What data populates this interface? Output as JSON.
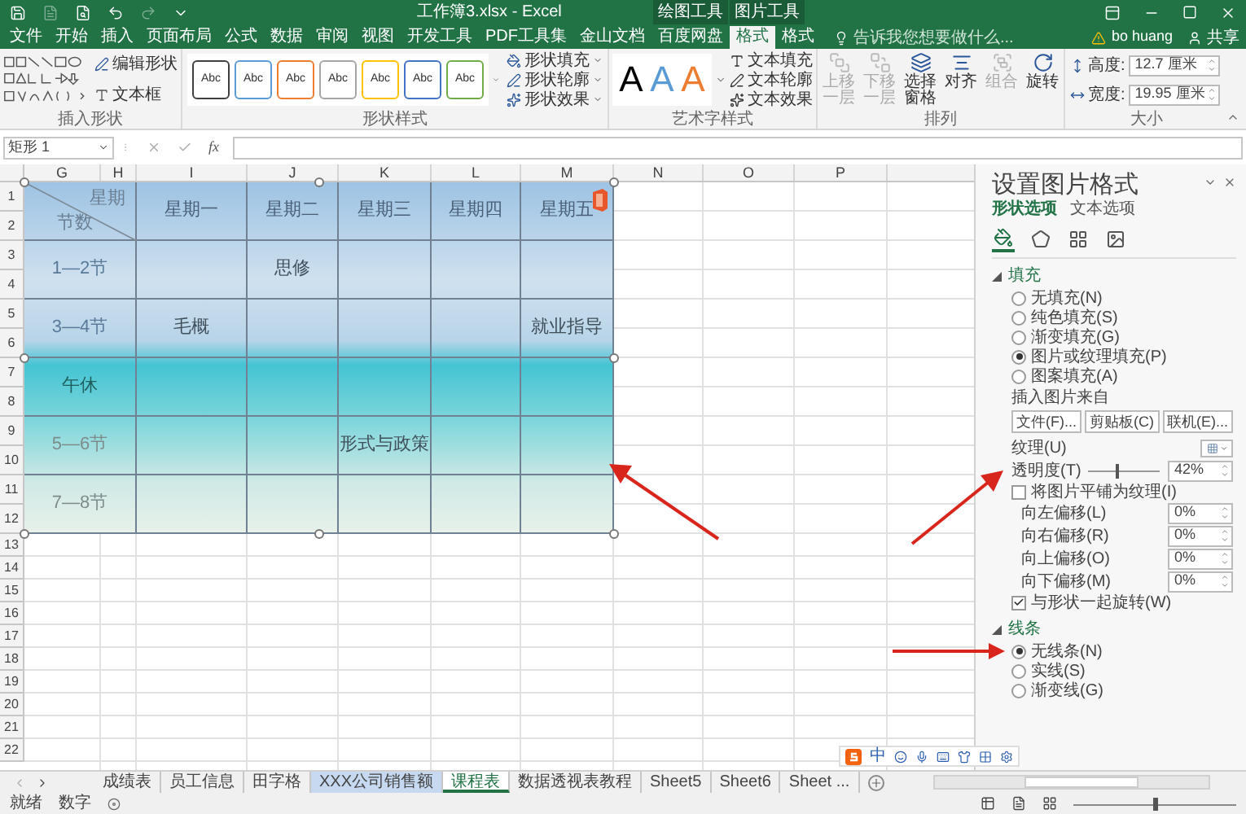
{
  "title_bar": {
    "title": "工作簿3.xlsx - Excel",
    "context_groups": [
      "绘图工具",
      "图片工具"
    ]
  },
  "ribbon_tabs": [
    {
      "label": "文件",
      "selected": false
    },
    {
      "label": "开始",
      "selected": false
    },
    {
      "label": "插入",
      "selected": false
    },
    {
      "label": "页面布局",
      "selected": false
    },
    {
      "label": "公式",
      "selected": false
    },
    {
      "label": "数据",
      "selected": false
    },
    {
      "label": "审阅",
      "selected": false
    },
    {
      "label": "视图",
      "selected": false
    },
    {
      "label": "开发工具",
      "selected": false
    },
    {
      "label": "PDF工具集",
      "selected": false
    },
    {
      "label": "金山文档",
      "selected": false
    },
    {
      "label": "百度网盘",
      "selected": false
    },
    {
      "label": "格式",
      "selected": true
    },
    {
      "label": "格式",
      "selected": false
    }
  ],
  "tell_me": {
    "placeholder": "告诉我您想要做什么..."
  },
  "account": {
    "user": "bo huang",
    "share": "共享"
  },
  "ribbon": {
    "insert_shapes": {
      "label": "插入形状",
      "edit_shape": "编辑形状",
      "text_box": "文本框"
    },
    "shape_styles": {
      "label": "形状样式",
      "presets": [
        {
          "text": "Abc",
          "color": "#404040"
        },
        {
          "text": "Abc",
          "color": "#5b9bd5"
        },
        {
          "text": "Abc",
          "color": "#ed7d31"
        },
        {
          "text": "Abc",
          "color": "#a5a5a5"
        },
        {
          "text": "Abc",
          "color": "#ffc000"
        },
        {
          "text": "Abc",
          "color": "#4472c4"
        },
        {
          "text": "Abc",
          "color": "#70ad47"
        }
      ],
      "commands": [
        "形状填充",
        "形状轮廓",
        "形状效果"
      ]
    },
    "wordart_styles": {
      "label": "艺术字样式",
      "presets": [
        {
          "text": "A",
          "color": "#000000"
        },
        {
          "text": "A",
          "color": "#5b9bd5"
        },
        {
          "text": "A",
          "color": "#ed7d31"
        }
      ],
      "commands": [
        "文本填充",
        "文本轮廓",
        "文本效果"
      ]
    },
    "arrange": {
      "label": "排列",
      "commands": [
        {
          "label": "上移一层",
          "disabled": true
        },
        {
          "label": "下移一层",
          "disabled": true
        },
        {
          "label": "选择窗格",
          "disabled": false
        },
        {
          "label": "对齐",
          "disabled": false
        },
        {
          "label": "组合",
          "disabled": true
        },
        {
          "label": "旋转",
          "disabled": false
        }
      ]
    },
    "size": {
      "label": "大小",
      "fields": [
        {
          "label": "高度:",
          "value": "12.7 厘米"
        },
        {
          "label": "宽度:",
          "value": "19.95 厘米"
        }
      ]
    }
  },
  "formula_bar": {
    "name_box": "矩形 1",
    "function_button": "fx"
  },
  "sheet": {
    "columns": [
      "G",
      "H",
      "I",
      "J",
      "K",
      "L",
      "M",
      "N",
      "O",
      "P"
    ],
    "rows": [
      "1",
      "2",
      "3",
      "4",
      "5",
      "6",
      "7",
      "8",
      "9",
      "10",
      "11",
      "12",
      "13",
      "14",
      "15",
      "16",
      "17",
      "18",
      "19",
      "20",
      "21",
      "22"
    ]
  },
  "picture": {
    "corner_top": "星期",
    "corner_bottom": "节数",
    "days": [
      "星期一",
      "星期二",
      "星期三",
      "星期四",
      "星期五"
    ],
    "periods": [
      {
        "label": "1—2节",
        "cells": [
          null,
          "思修",
          null,
          null,
          null
        ]
      },
      {
        "label": "3—4节",
        "cells": [
          "毛概",
          null,
          null,
          null,
          "就业指导"
        ]
      },
      {
        "label": "午休",
        "cells": [
          null,
          null,
          null,
          null,
          null
        ]
      },
      {
        "label": "5—6节",
        "cells": [
          null,
          null,
          "形式与政策",
          null,
          null
        ]
      },
      {
        "label": "7—8节",
        "cells": [
          null,
          null,
          null,
          null,
          null
        ]
      }
    ]
  },
  "panel": {
    "title": "设置图片格式",
    "tabs": [
      {
        "label": "形状选项",
        "selected": true
      },
      {
        "label": "文本选项",
        "selected": false
      }
    ],
    "icon_tabs": [
      {
        "kind": "fill",
        "selected": true
      },
      {
        "kind": "effects",
        "selected": false
      },
      {
        "kind": "size",
        "selected": false
      },
      {
        "kind": "picture",
        "selected": false
      }
    ],
    "fill": {
      "label": "填充",
      "expanded": true,
      "options": [
        {
          "label": "无填充(N)",
          "selected": false
        },
        {
          "label": "纯色填充(S)",
          "selected": false
        },
        {
          "label": "渐变填充(G)",
          "selected": false
        },
        {
          "label": "图片或纹理填充(P)",
          "selected": true
        },
        {
          "label": "图案填充(A)",
          "selected": false
        }
      ],
      "source_label": "插入图片来自",
      "buttons": [
        "文件(F)...",
        "剪贴板(C)",
        "联机(E)..."
      ],
      "texture_label": "纹理(U)",
      "transparency": {
        "label": "透明度(T)",
        "level": 0.42,
        "value": "42%"
      },
      "tile": {
        "label": "将图片平铺为纹理(I)",
        "checked": false
      },
      "offsets": [
        {
          "label": "向左偏移(L)",
          "value": "0%"
        },
        {
          "label": "向右偏移(R)",
          "value": "0%"
        },
        {
          "label": "向上偏移(O)",
          "value": "0%"
        },
        {
          "label": "向下偏移(M)",
          "value": "0%"
        }
      ],
      "rotate": {
        "label": "与形状一起旋转(W)",
        "checked": true
      }
    },
    "line": {
      "label": "线条",
      "expanded": true,
      "options": [
        {
          "label": "无线条(N)",
          "selected": true
        },
        {
          "label": "实线(S)",
          "selected": false
        },
        {
          "label": "渐变线(G)",
          "selected": false
        }
      ]
    }
  },
  "sheet_tabs": [
    {
      "label": "成绩表",
      "selected": false
    },
    {
      "label": "员工信息",
      "selected": false
    },
    {
      "label": "田字格",
      "selected": false
    },
    {
      "label": "XXX公司销售额",
      "selected": false,
      "color": "#c6d9f0"
    },
    {
      "label": "课程表",
      "selected": true
    },
    {
      "label": "数据透视表教程",
      "selected": false
    },
    {
      "label": "Sheet5",
      "selected": false
    },
    {
      "label": "Sheet6",
      "selected": false
    },
    {
      "label": "Sheet ...",
      "selected": false
    }
  ],
  "ime_bar": {
    "mode": "中"
  },
  "status_bar": {
    "items": [
      "就绪",
      "数字"
    ],
    "zoom": {
      "level": 0.5
    }
  }
}
